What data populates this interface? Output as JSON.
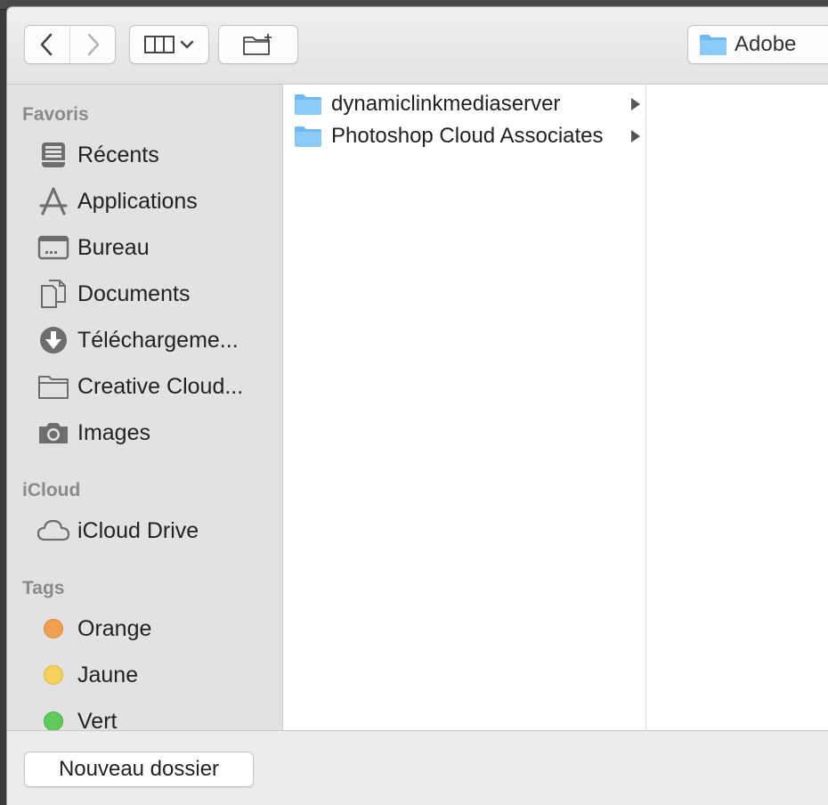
{
  "toolbar": {
    "back_icon": "chevron-left-icon",
    "forward_icon": "chevron-right-icon",
    "view_icon": "column-view-icon",
    "new_folder_icon": "folder-add-icon",
    "location": "Adobe"
  },
  "sidebar": {
    "sections": {
      "favorites": "Favoris",
      "icloud": "iCloud",
      "tags": "Tags"
    },
    "favorites": [
      {
        "label": "Récents",
        "icon": "recents-icon"
      },
      {
        "label": "Applications",
        "icon": "applications-icon"
      },
      {
        "label": "Bureau",
        "icon": "desktop-icon"
      },
      {
        "label": "Documents",
        "icon": "documents-icon"
      },
      {
        "label": "Téléchargeme...",
        "icon": "downloads-icon"
      },
      {
        "label": "Creative Cloud...",
        "icon": "folder-icon"
      },
      {
        "label": "Images",
        "icon": "camera-icon"
      }
    ],
    "icloud": [
      {
        "label": "iCloud Drive",
        "icon": "cloud-icon"
      }
    ],
    "tags": [
      {
        "label": "Orange",
        "color": "#f0a050"
      },
      {
        "label": "Jaune",
        "color": "#f6d15e"
      },
      {
        "label": "Vert",
        "color": "#5fcb5a"
      }
    ]
  },
  "browser": {
    "items": [
      {
        "name": "dynamiclinkmediaserver",
        "icon": "folder-icon"
      },
      {
        "name": "Photoshop Cloud Associates",
        "icon": "folder-icon"
      }
    ]
  },
  "footer": {
    "new_folder_label": "Nouveau dossier"
  },
  "colors": {
    "folder_blue": "#6fb8f2",
    "sidebar_bg": "#e2e2e2",
    "icon_gray": "#6e6e6e"
  }
}
